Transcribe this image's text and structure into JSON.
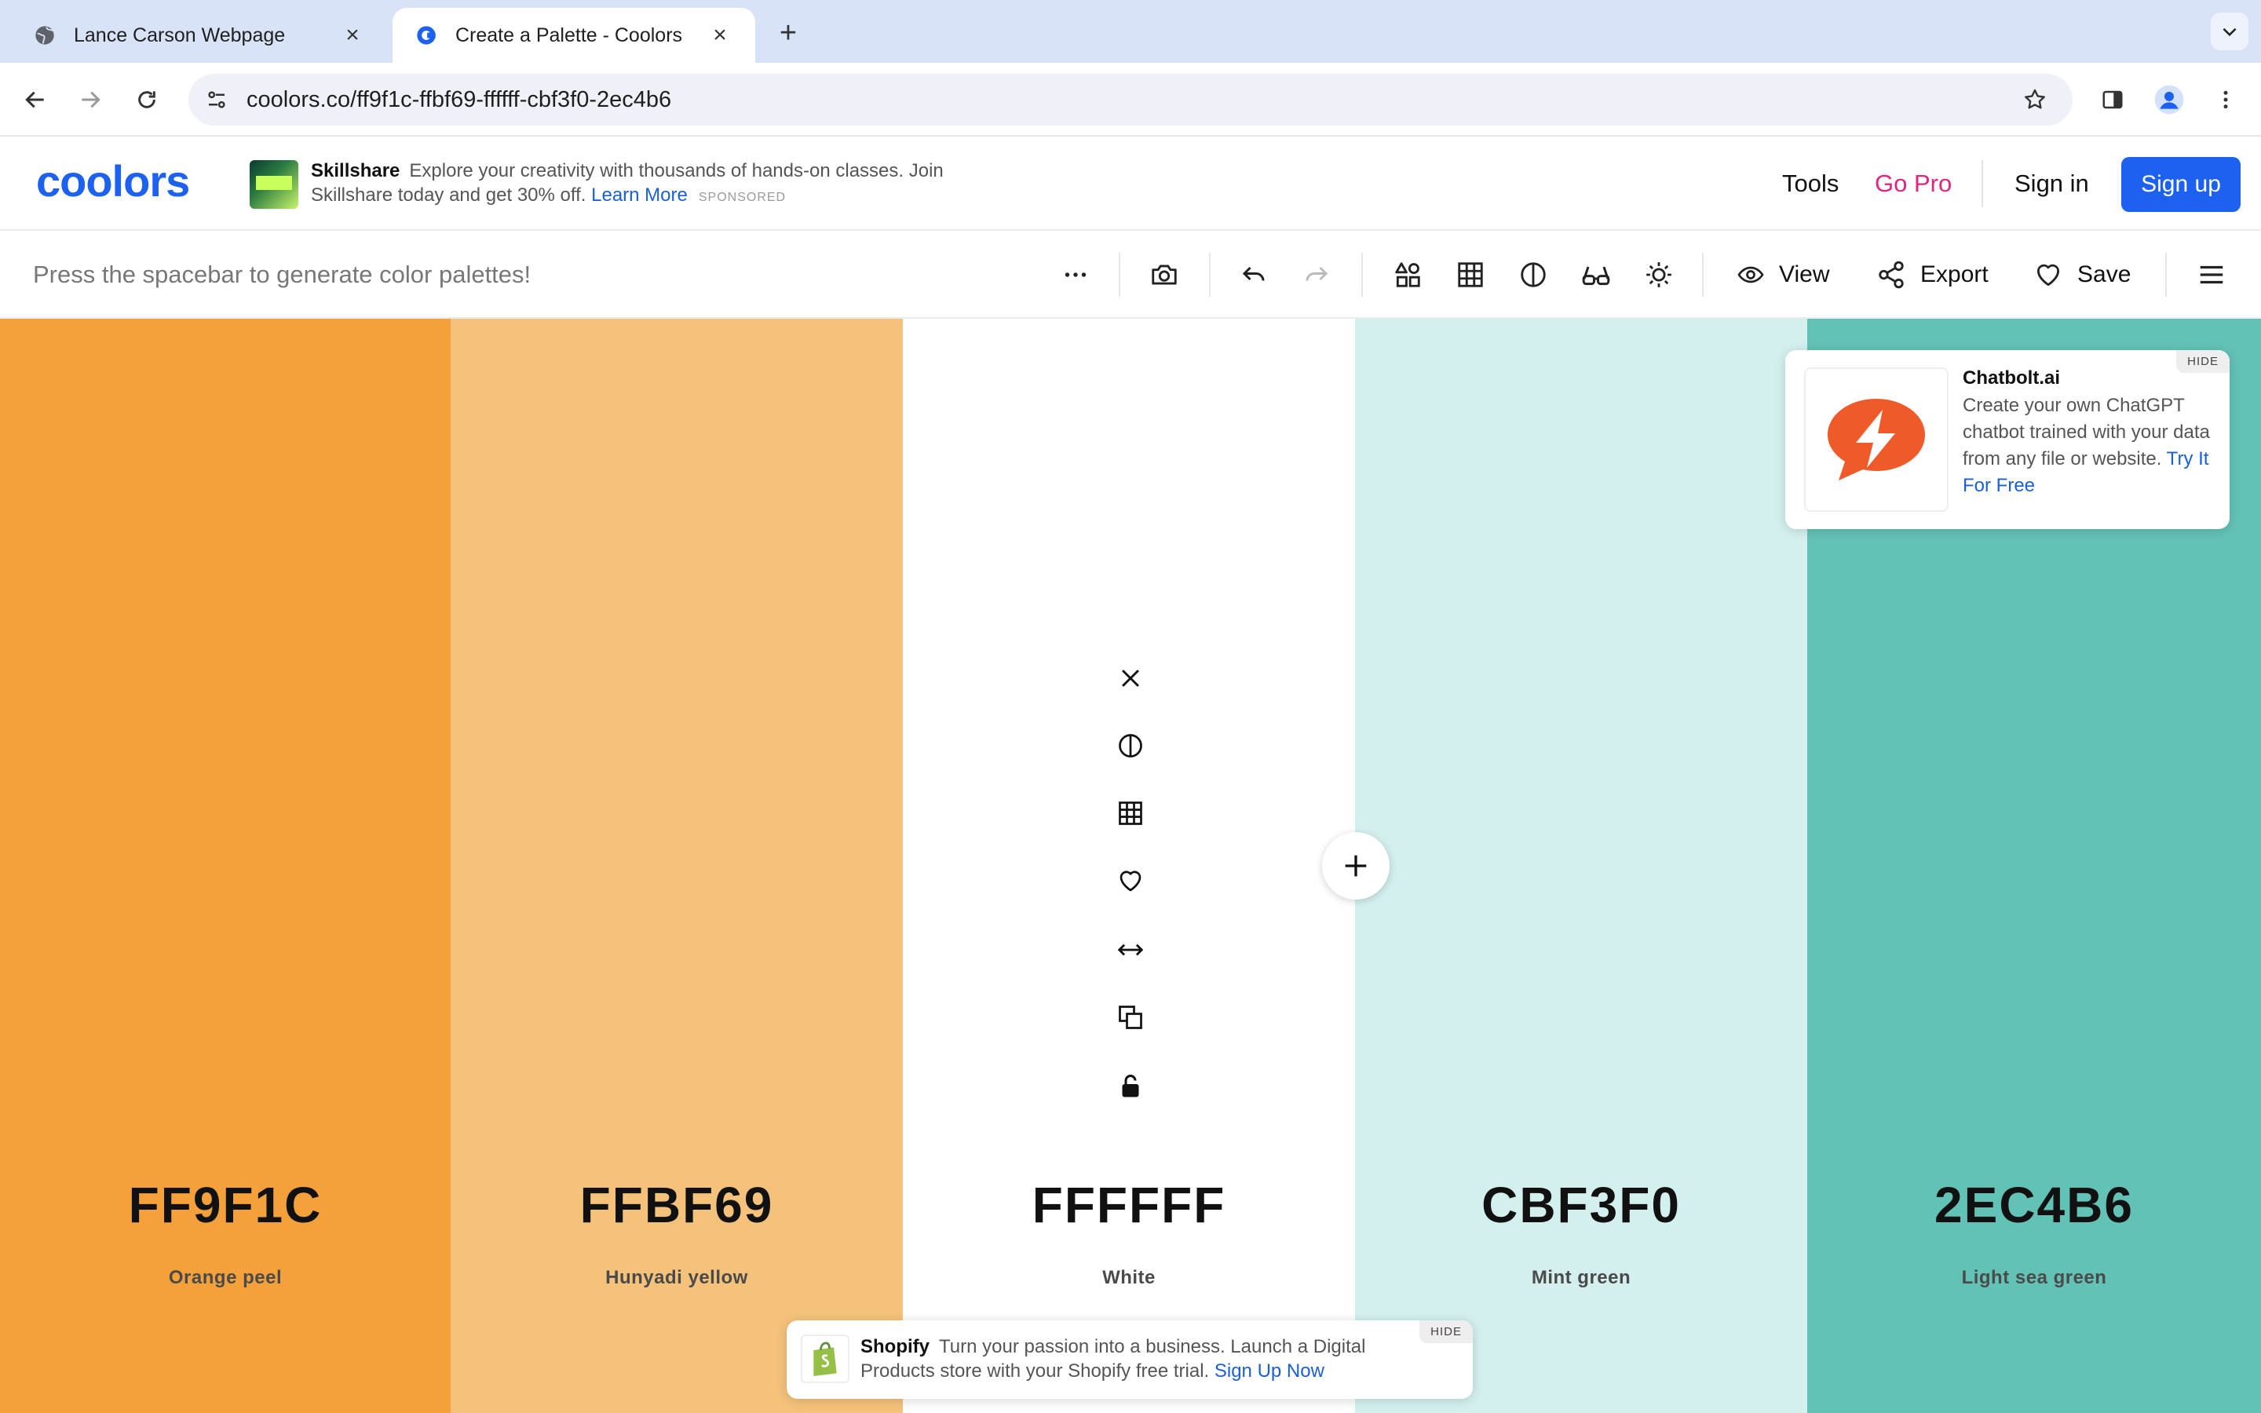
{
  "browser": {
    "tabs": [
      {
        "title": "Lance Carson Webpage",
        "active": false
      },
      {
        "title": "Create a Palette - Coolors",
        "active": true
      }
    ],
    "url": "coolors.co/ff9f1c-ffbf69-ffffff-cbf3f0-2ec4b6"
  },
  "header": {
    "logo": "coolors",
    "ad": {
      "brand": "Skillshare",
      "text": "Explore your creativity with thousands of hands-on classes. Join Skillshare today and get 30% off.",
      "link": "Learn More",
      "sponsored": "SPONSORED"
    },
    "nav": {
      "tools": "Tools",
      "pro": "Go Pro",
      "signin": "Sign in",
      "signup": "Sign up"
    }
  },
  "toolbar": {
    "hint": "Press the spacebar to generate color palettes!",
    "view": "View",
    "export": "Export",
    "save": "Save"
  },
  "palette": [
    {
      "hex": "FF9F1C",
      "name": "Orange peel",
      "color": "#F4A13C"
    },
    {
      "hex": "FFBF69",
      "name": "Hunyadi yellow",
      "color": "#F4C27A"
    },
    {
      "hex": "FFFFFF",
      "name": "White",
      "color": "#FFFFFF"
    },
    {
      "hex": "CBF3F0",
      "name": "Mint green",
      "color": "#D3F0EE"
    },
    {
      "hex": "2EC4B6",
      "name": "Light sea green",
      "color": "#63C2B6"
    }
  ],
  "ads": {
    "chatbolt": {
      "title": "Chatbolt.ai",
      "text": "Create your own ChatGPT chatbot trained with your data from any file or website.",
      "link": "Try It For Free",
      "hide": "HIDE"
    },
    "shopify": {
      "brand": "Shopify",
      "text": "Turn your passion into a business. Launch a Digital Products store with your Shopify free trial.",
      "link": "Sign Up Now",
      "hide": "HIDE"
    }
  },
  "colors": {
    "accent": "#1D61F0",
    "pro": "#E0267E",
    "chatbolt_orange": "#F05A28",
    "shopify_green": "#95BF47"
  }
}
